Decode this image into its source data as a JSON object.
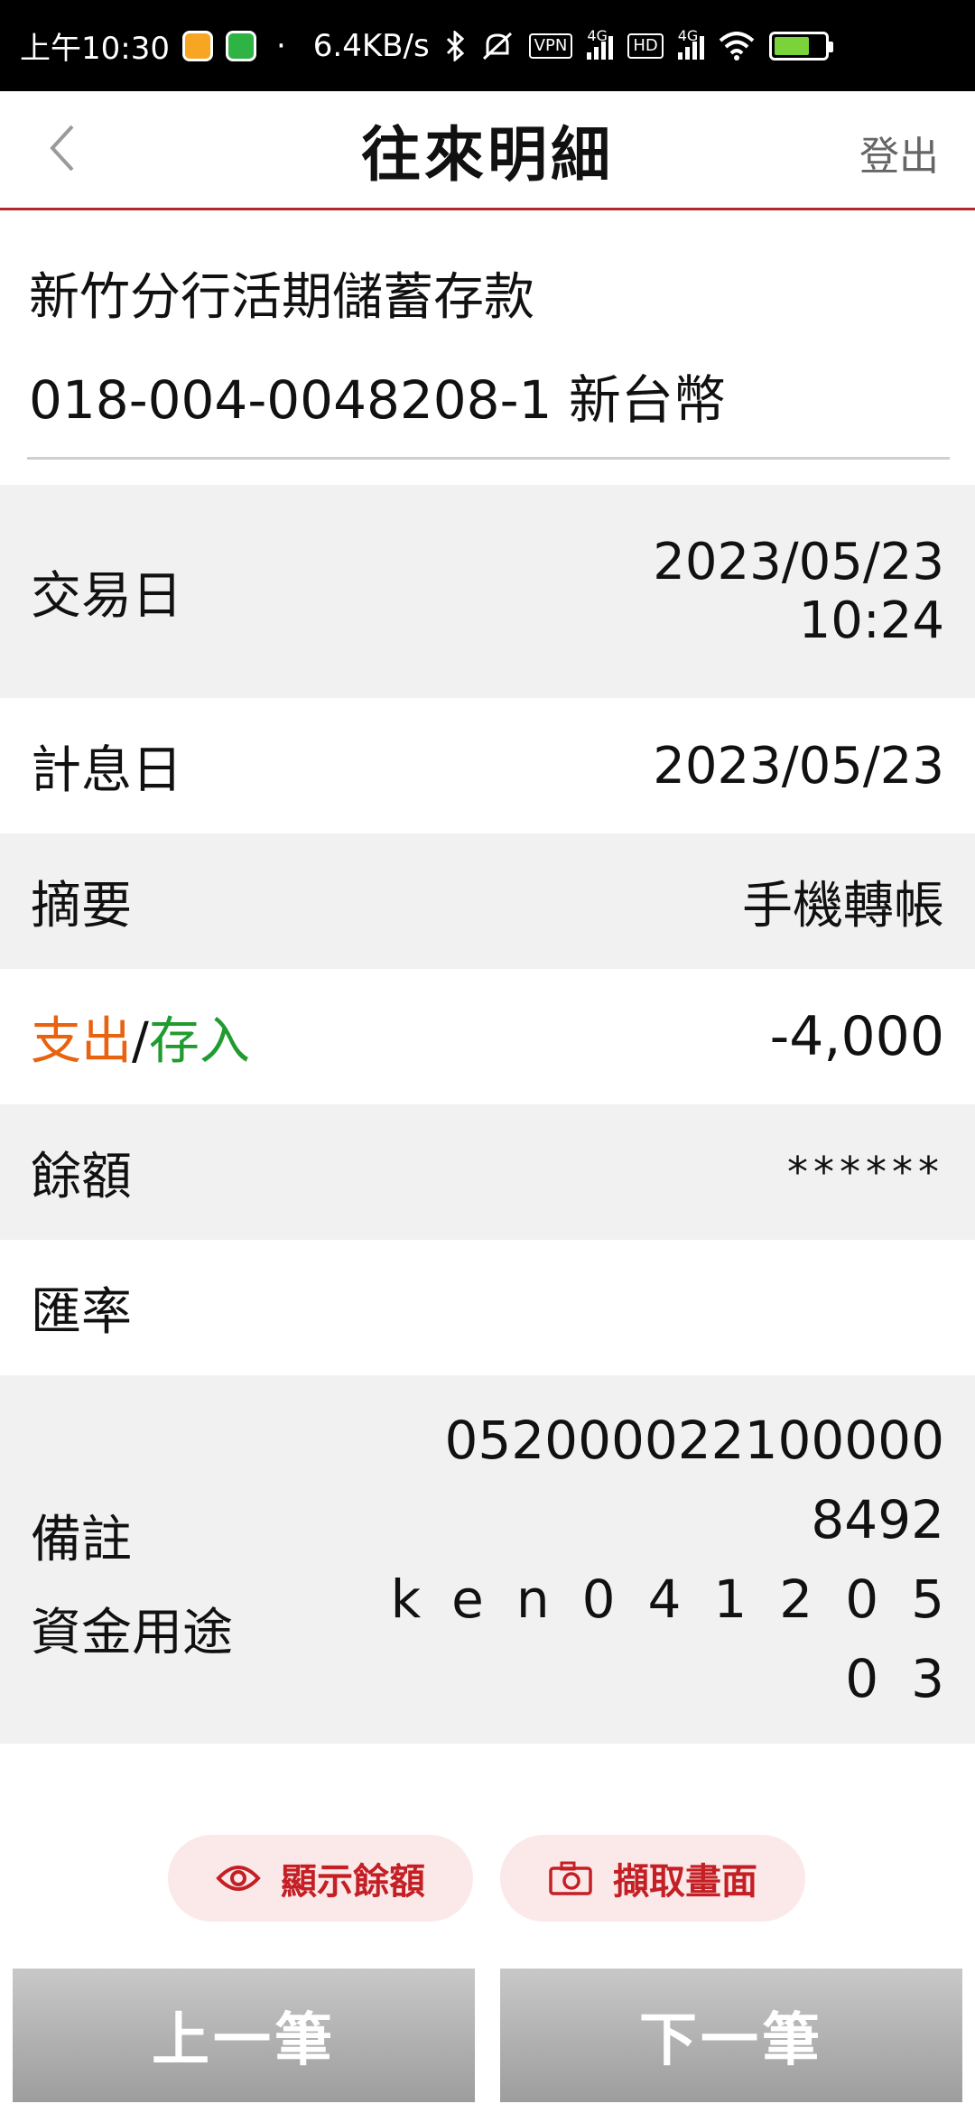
{
  "status_bar": {
    "time": "上午10:30",
    "dot": "·",
    "network_speed": "6.4KB/s",
    "vpn_label": "VPN",
    "hd_label": "HD",
    "net_type_1": "4G",
    "net_type_2": "4G",
    "icons": [
      "bluetooth-icon",
      "mute-icon",
      "signal-icon",
      "wifi-icon",
      "battery-icon"
    ]
  },
  "header": {
    "title": "往來明細",
    "logout_label": "登出"
  },
  "account": {
    "name": "新竹分行活期儲蓄存款",
    "number": "018-004-0048208-1 新台幣"
  },
  "details": {
    "trade_date": {
      "label": "交易日",
      "date": "2023/05/23",
      "time": "10:24"
    },
    "value_date": {
      "label": "計息日",
      "value": "2023/05/23"
    },
    "summary": {
      "label": "摘要",
      "value": "手機轉帳"
    },
    "amount": {
      "label_out": "支出",
      "label_sep": "/",
      "label_in": "存入",
      "value": "-4,000"
    },
    "balance": {
      "label": "餘額",
      "value": "******"
    },
    "exchange_rate": {
      "label": "匯率",
      "value": ""
    },
    "remark": {
      "label": "備註",
      "label2": "資金用途",
      "line1": "052000022100000",
      "line2": "8492",
      "line3": "ken041205",
      "line4": "03"
    }
  },
  "actions": {
    "show_balance": "顯示餘額",
    "capture_screen": "擷取畫面"
  },
  "nav": {
    "prev": "上一筆",
    "next": "下一筆"
  },
  "colors": {
    "accent": "#b5262d",
    "out": "#e8620f",
    "in": "#1f9b2f",
    "pill_text": "#c41f24"
  }
}
